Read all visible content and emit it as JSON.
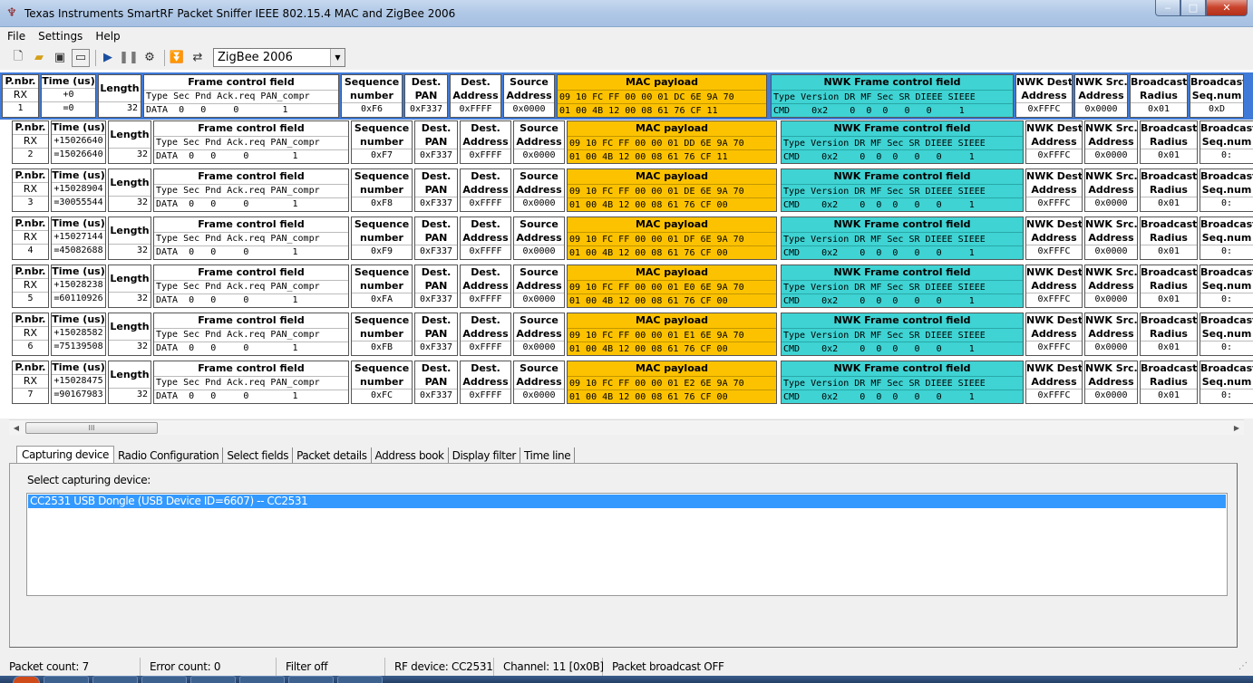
{
  "window": {
    "title": "Texas Instruments SmartRF Packet Sniffer IEEE 802.15.4 MAC and ZigBee 2006"
  },
  "menu": [
    "File",
    "Settings",
    "Help"
  ],
  "toolbar": {
    "protocol": "ZigBee 2006"
  },
  "headers": {
    "pnbr": "P.nbr.",
    "rx": "RX",
    "time": "Time (us)",
    "length": "Length",
    "fcf": "Frame control field",
    "fcf_cols": "Type Sec Pnd Ack.req PAN_compr",
    "seq_a": "Sequence",
    "seq_b": "number",
    "dpan_a": "Dest.",
    "dpan_b": "PAN",
    "daddr_a": "Dest.",
    "daddr_b": "Address",
    "saddr_a": "Source",
    "saddr_b": "Address",
    "mac": "MAC payload",
    "nwk": "NWK Frame control field",
    "nwk_cols": "Type Version DR MF Sec SR DIEEE SIEEE",
    "nwkd_a": "NWK Dest.",
    "nwkd_b": "Address",
    "nwks_a": "NWK Src.",
    "nwks_b": "Address",
    "bc_a": "Broadcast",
    "bc_b": "Radius",
    "bs_a": "Broadcast",
    "bs_b": "Seq.num"
  },
  "packets": [
    {
      "nbr": "1",
      "t1": "+0",
      "t2": "=0",
      "length": "32",
      "fcf": "DATA  0   0     0        1",
      "seq": "0xF6",
      "dpan": "0xF337",
      "daddr": "0xFFFF",
      "saddr": "0x0000",
      "mac1": "09 10 FC FF 00 00 01 DC 6E 9A 70",
      "mac2": "01 00 4B 12 00 08 61 76 CF 11",
      "nwk": "CMD    0x2    0  0  0   0   0     1",
      "nwkd": "0xFFFC",
      "nwks": "0x0000",
      "radius": "0x01",
      "bseq": "0xD"
    },
    {
      "nbr": "2",
      "t1": "+15026640",
      "t2": "=15026640",
      "length": "32",
      "fcf": "DATA  0   0     0        1",
      "seq": "0xF7",
      "dpan": "0xF337",
      "daddr": "0xFFFF",
      "saddr": "0x0000",
      "mac1": "09 10 FC FF 00 00 01 DD 6E 9A 70",
      "mac2": "01 00 4B 12 00 08 61 76 CF 11",
      "nwk": "CMD    0x2    0  0  0   0   0     1",
      "nwkd": "0xFFFC",
      "nwks": "0x0000",
      "radius": "0x01",
      "bseq": "0:"
    },
    {
      "nbr": "3",
      "t1": "+15028904",
      "t2": "=30055544",
      "length": "32",
      "fcf": "DATA  0   0     0        1",
      "seq": "0xF8",
      "dpan": "0xF337",
      "daddr": "0xFFFF",
      "saddr": "0x0000",
      "mac1": "09 10 FC FF 00 00 01 DE 6E 9A 70",
      "mac2": "01 00 4B 12 00 08 61 76 CF 00",
      "nwk": "CMD    0x2    0  0  0   0   0     1",
      "nwkd": "0xFFFC",
      "nwks": "0x0000",
      "radius": "0x01",
      "bseq": "0:"
    },
    {
      "nbr": "4",
      "t1": "+15027144",
      "t2": "=45082688",
      "length": "32",
      "fcf": "DATA  0   0     0        1",
      "seq": "0xF9",
      "dpan": "0xF337",
      "daddr": "0xFFFF",
      "saddr": "0x0000",
      "mac1": "09 10 FC FF 00 00 01 DF 6E 9A 70",
      "mac2": "01 00 4B 12 00 08 61 76 CF 00",
      "nwk": "CMD    0x2    0  0  0   0   0     1",
      "nwkd": "0xFFFC",
      "nwks": "0x0000",
      "radius": "0x01",
      "bseq": "0:"
    },
    {
      "nbr": "5",
      "t1": "+15028238",
      "t2": "=60110926",
      "length": "32",
      "fcf": "DATA  0   0     0        1",
      "seq": "0xFA",
      "dpan": "0xF337",
      "daddr": "0xFFFF",
      "saddr": "0x0000",
      "mac1": "09 10 FC FF 00 00 01 E0 6E 9A 70",
      "mac2": "01 00 4B 12 00 08 61 76 CF 00",
      "nwk": "CMD    0x2    0  0  0   0   0     1",
      "nwkd": "0xFFFC",
      "nwks": "0x0000",
      "radius": "0x01",
      "bseq": "0:"
    },
    {
      "nbr": "6",
      "t1": "+15028582",
      "t2": "=75139508",
      "length": "32",
      "fcf": "DATA  0   0     0        1",
      "seq": "0xFB",
      "dpan": "0xF337",
      "daddr": "0xFFFF",
      "saddr": "0x0000",
      "mac1": "09 10 FC FF 00 00 01 E1 6E 9A 70",
      "mac2": "01 00 4B 12 00 08 61 76 CF 00",
      "nwk": "CMD    0x2    0  0  0   0   0     1",
      "nwkd": "0xFFFC",
      "nwks": "0x0000",
      "radius": "0x01",
      "bseq": "0:"
    },
    {
      "nbr": "7",
      "t1": "+15028475",
      "t2": "=90167983",
      "length": "32",
      "fcf": "DATA  0   0     0        1",
      "seq": "0xFC",
      "dpan": "0xF337",
      "daddr": "0xFFFF",
      "saddr": "0x0000",
      "mac1": "09 10 FC FF 00 00 01 E2 6E 9A 70",
      "mac2": "01 00 4B 12 00 08 61 76 CF 00",
      "nwk": "CMD    0x2    0  0  0   0   0     1",
      "nwkd": "0xFFFC",
      "nwks": "0x0000",
      "radius": "0x01",
      "bseq": "0:"
    }
  ],
  "scrollbar": {
    "thumb_grip": "III"
  },
  "tabs": [
    "Capturing device",
    "Radio Configuration",
    "Select fields",
    "Packet details",
    "Address book",
    "Display filter",
    "Time line"
  ],
  "capture": {
    "label": "Select capturing device:",
    "devices": [
      "CC2531 USB Dongle (USB Device ID=6607) -- CC2531"
    ]
  },
  "status": {
    "packet_count": "Packet count: 7",
    "error_count": "Error count: 0",
    "filter": "Filter off",
    "rf_device": "RF device: CC2531",
    "channel": "Channel: 11 [0x0B]",
    "broadcast": "Packet broadcast OFF"
  },
  "icons": {
    "app": "ti-logo-icon",
    "new": "new-file-icon",
    "open": "open-folder-icon",
    "save": "save-icon",
    "clear": "clear-icon",
    "start": "play-icon",
    "pause": "pause-icon",
    "settings": "gear-icon",
    "scroll": "autoscroll-icon",
    "lookup": "address-lookup-icon"
  },
  "colors": {
    "mac_payload": "#fcc200",
    "nwk_field": "#3fd3d3",
    "selection": "#3f7ad8"
  }
}
